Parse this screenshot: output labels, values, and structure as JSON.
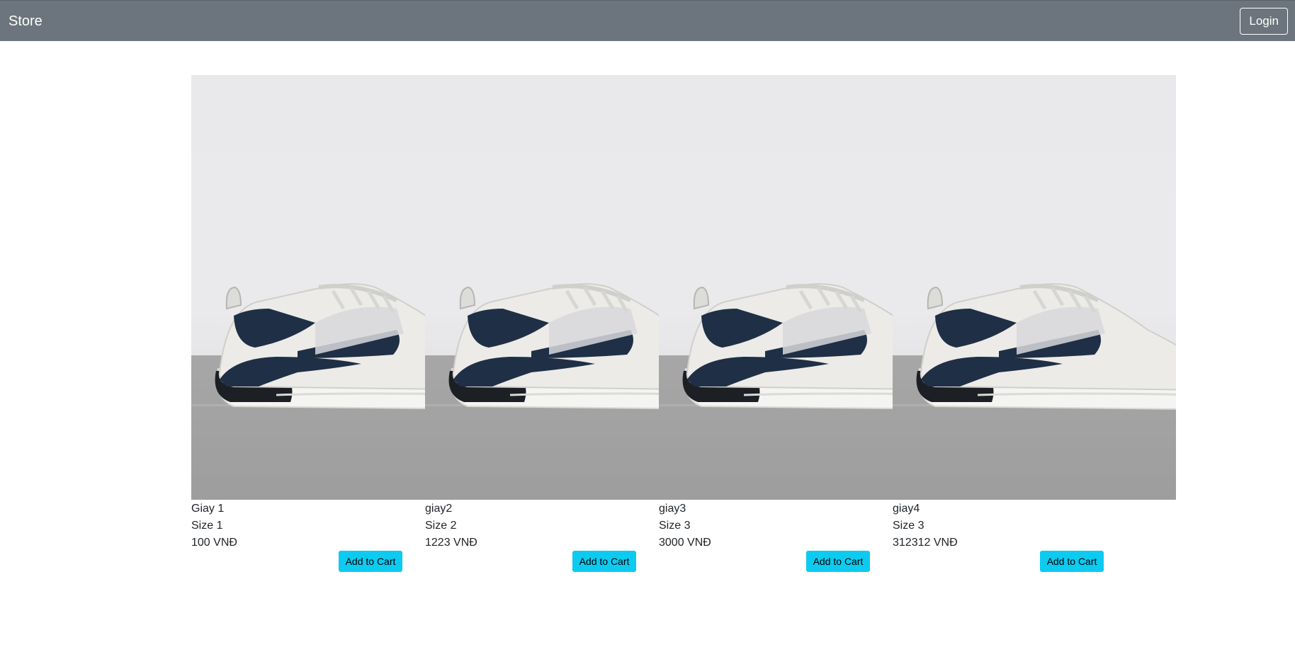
{
  "navbar": {
    "brand": "Store",
    "login_label": "Login",
    "background": "#6c757d"
  },
  "products": [
    {
      "name": "Giay 1",
      "size": "Size 1",
      "price": "100 VNĐ",
      "button_label": "Add to Cart",
      "image_icon": "sneaker-image"
    },
    {
      "name": "giay2",
      "size": "Size 2",
      "price": "1223 VNĐ",
      "button_label": "Add to Cart",
      "image_icon": "sneaker-image"
    },
    {
      "name": "giay3",
      "size": "Size 3",
      "price": "3000 VNĐ",
      "button_label": "Add to Cart",
      "image_icon": "sneaker-image"
    },
    {
      "name": "giay4",
      "size": "Size 3",
      "price": "312312 VNĐ",
      "button_label": "Add to Cart",
      "image_icon": "sneaker-image"
    }
  ],
  "colors": {
    "accent_button": "#0dcaf0",
    "sneaker_navy": "#1f2f45"
  }
}
